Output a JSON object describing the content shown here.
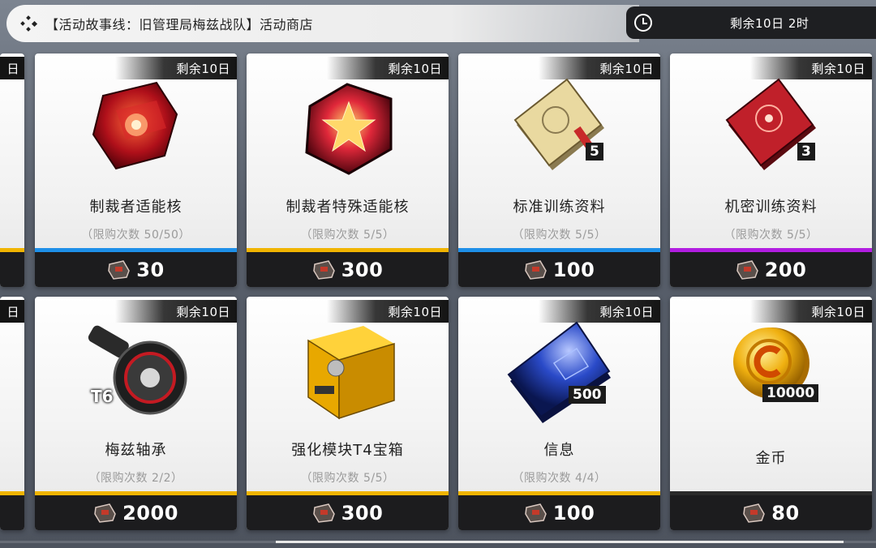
{
  "header": {
    "title": "【活动故事线：旧管理局梅兹战队】活动商店",
    "timer": "剩余10日 2时",
    "menu_icon": "dots-icon",
    "clock_icon": "clock-icon"
  },
  "cards": [
    {
      "badge": "剩余10日",
      "name": "制裁者适能核",
      "limit": "（限购次数 50/50）",
      "price": "30",
      "rarity_color": "#1e8fe8",
      "qty": ""
    },
    {
      "badge": "剩余10日",
      "name": "制裁者特殊适能核",
      "limit": "（限购次数 5/5）",
      "price": "300",
      "rarity_color": "#f0b400",
      "qty": ""
    },
    {
      "badge": "剩余10日",
      "name": "标准训练资料",
      "limit": "（限购次数 5/5）",
      "price": "100",
      "rarity_color": "#1e8fe8",
      "qty": "5"
    },
    {
      "badge": "剩余10日",
      "name": "机密训练资料",
      "limit": "（限购次数 5/5）",
      "price": "200",
      "rarity_color": "#b11de0",
      "qty": "3"
    },
    {
      "badge": "剩余10日",
      "name": "梅兹轴承",
      "limit": "（限购次数 2/2）",
      "price": "2000",
      "rarity_color": "#f0b400",
      "qty": "T6"
    },
    {
      "badge": "剩余10日",
      "name": "强化模块T4宝箱",
      "limit": "（限购次数 5/5）",
      "price": "300",
      "rarity_color": "#f0b400",
      "qty": ""
    },
    {
      "badge": "剩余10日",
      "name": "信息",
      "limit": "（限购次数 4/4）",
      "price": "100",
      "rarity_color": "#f0b400",
      "qty": "500"
    },
    {
      "badge": "剩余10日",
      "name": "金币",
      "limit": "",
      "price": "80",
      "rarity_color": "#2a2a2a",
      "qty": "10000"
    }
  ],
  "partial_cards": [
    {
      "badge": "日",
      "rarity_color": "#f0b400"
    },
    {
      "badge": "日",
      "rarity_color": "#f0b400"
    }
  ],
  "colors": {
    "blue_rarity": "#1e8fe8",
    "gold_rarity": "#f0b400",
    "purple_rarity": "#b11de0",
    "price_bg": "#1c1c1e"
  }
}
